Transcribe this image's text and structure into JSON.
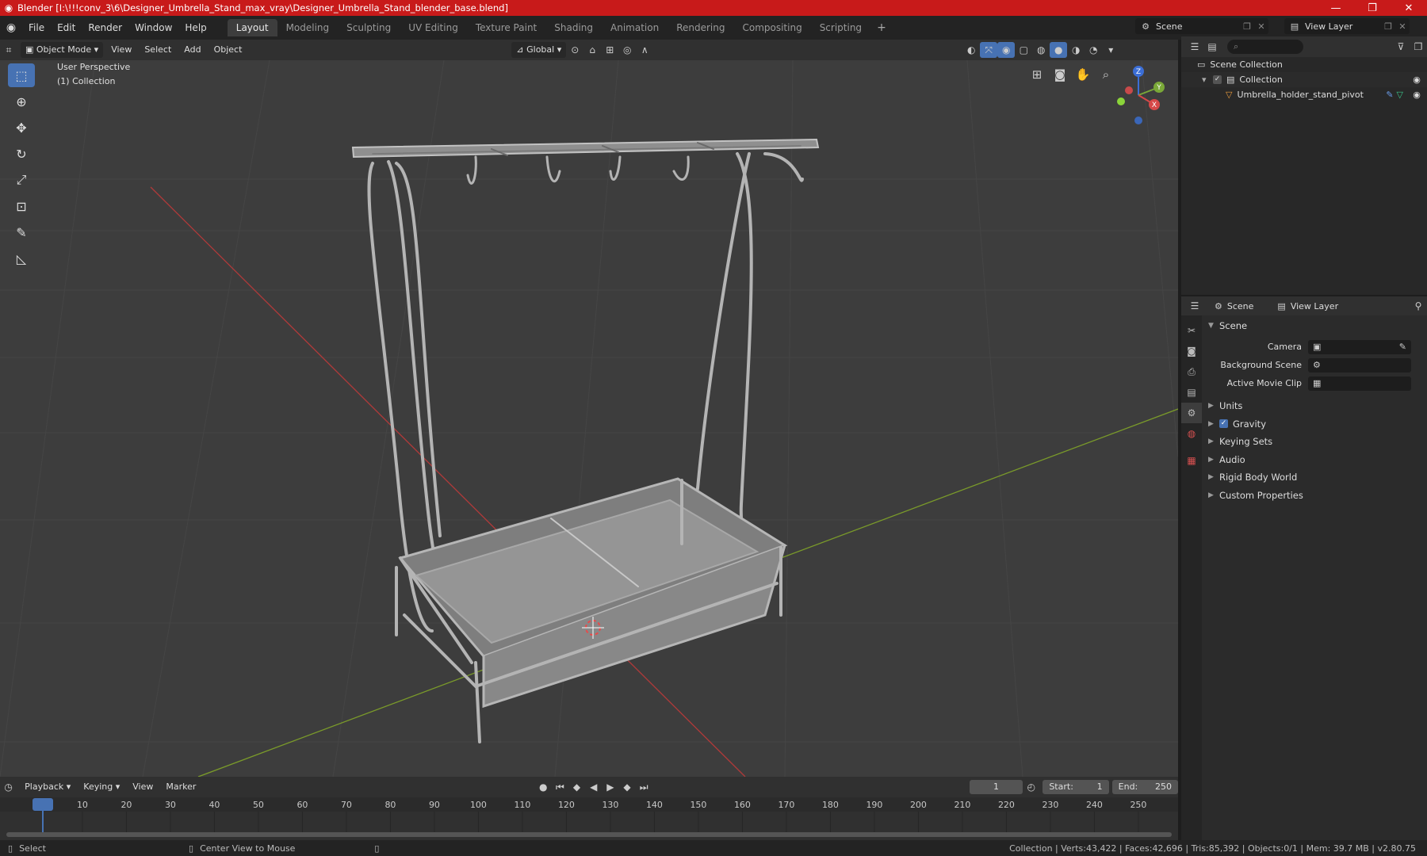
{
  "window": {
    "title": "Blender [I:\\!!!conv_3\\6\\Designer_Umbrella_Stand_max_vray\\Designer_Umbrella_Stand_blender_base.blend]",
    "minimize": "—",
    "maximize": "❐",
    "close": "✕"
  },
  "menu": [
    "File",
    "Edit",
    "Render",
    "Window",
    "Help"
  ],
  "workspaces": [
    "Layout",
    "Modeling",
    "Sculpting",
    "UV Editing",
    "Texture Paint",
    "Shading",
    "Animation",
    "Rendering",
    "Compositing",
    "Scripting"
  ],
  "workspace_add": "+",
  "scene_selector": {
    "value": "Scene"
  },
  "view_layer_selector": {
    "value": "View Layer"
  },
  "viewport_header": {
    "mode": "Object Mode",
    "menus": [
      "View",
      "Select",
      "Add",
      "Object"
    ],
    "transform_orientation": "Global"
  },
  "viewport": {
    "perspective": "User Perspective",
    "collection": "(1) Collection",
    "gizmo": {
      "z": "Z",
      "y": "Y",
      "x": "X"
    }
  },
  "timeline": {
    "menus": [
      "Playback",
      "Keying",
      "View",
      "Marker"
    ],
    "current_frame": "1",
    "start_label": "Start:",
    "start": "1",
    "end_label": "End:",
    "end": "250",
    "ruler": [
      "1",
      "10",
      "20",
      "30",
      "40",
      "50",
      "60",
      "70",
      "80",
      "90",
      "100",
      "110",
      "120",
      "130",
      "140",
      "150",
      "160",
      "170",
      "180",
      "190",
      "200",
      "210",
      "220",
      "230",
      "240",
      "250"
    ]
  },
  "status": {
    "left_action": "Select",
    "middle_action": "Center View to Mouse",
    "stats": "Collection | Verts:43,422 | Faces:42,696 | Tris:85,392 | Objects:0/1 | Mem: 39.7 MB | v2.80.75"
  },
  "outliner": {
    "search_placeholder": "",
    "root": "Scene Collection",
    "collection": "Collection",
    "object": "Umbrella_holder_stand_pivot"
  },
  "properties": {
    "tabs_header": {
      "scene": "Scene",
      "view_layer": "View Layer"
    },
    "panel_title": "Scene",
    "fields": [
      {
        "label": "Camera",
        "value": ""
      },
      {
        "label": "Background Scene",
        "value": ""
      },
      {
        "label": "Active Movie Clip",
        "value": ""
      }
    ],
    "subpanels": [
      "Units",
      "Gravity",
      "Keying Sets",
      "Audio",
      "Rigid Body World",
      "Custom Properties"
    ],
    "gravity_enabled": true
  },
  "colors": {
    "titlebar": "#c81a1a",
    "accent": "#4772b3",
    "viewport_bg": "#3d3d3d",
    "axis_x": "#b03a3a",
    "axis_y": "#7a9a2a"
  }
}
